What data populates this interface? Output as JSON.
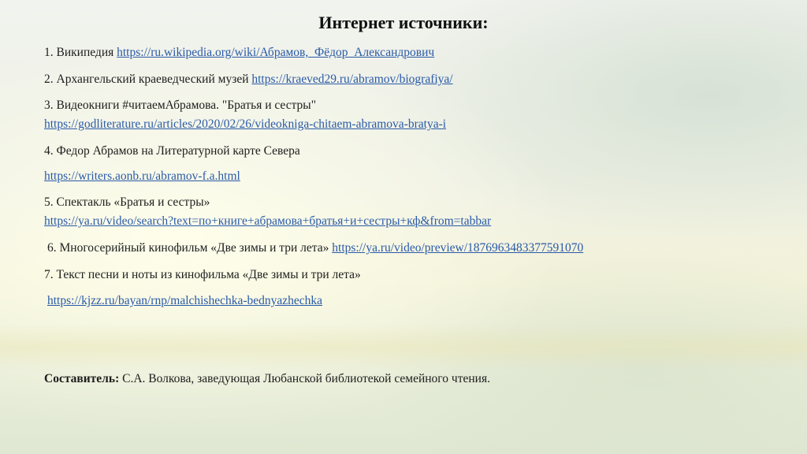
{
  "slide": {
    "title": "Интернет источники:",
    "items": [
      {
        "prefix": "1. Википедия ",
        "link": "https://ru.wikipedia.org/wiki/Абрамов,_Фёдор_Александрович"
      },
      {
        "prefix": "2. Архангельский краеведческий музей ",
        "link": "https://kraeved29.ru/abramov/biografiya/"
      },
      {
        "prefix": "3. Видеокниги #читаемАбрамова. \"Братья и сестры\"",
        "link": "https://godliterature.ru/articles/2020/02/26/videokniga-chitaem-abramova-bratya-i"
      },
      {
        "prefix": "4. Федор Абрамов на Литературной карте Севера",
        "link": "https://writers.aonb.ru/abramov-f.a.html"
      },
      {
        "prefix": "5. Спектакль «Братья и сестры»",
        "link": "https://ya.ru/video/search?text=по+книге+абрамова+братья+и+сестры+кф&from=tabbar"
      },
      {
        "prefix": "6. Многосерийный кинофильм «Две зимы и три лета» ",
        "link": "https://ya.ru/video/preview/1876963483377591070"
      },
      {
        "prefix": "7. Текст песни и ноты из кинофильма «Две зимы и три лета»",
        "link": "https://kjzz.ru/bayan/rnp/malchishechka-bednyazhechka"
      }
    ],
    "credit": {
      "label": "Составитель:",
      "text": " С.А. Волкова, заведующая Любанской библиотекой семейного чтения."
    }
  }
}
